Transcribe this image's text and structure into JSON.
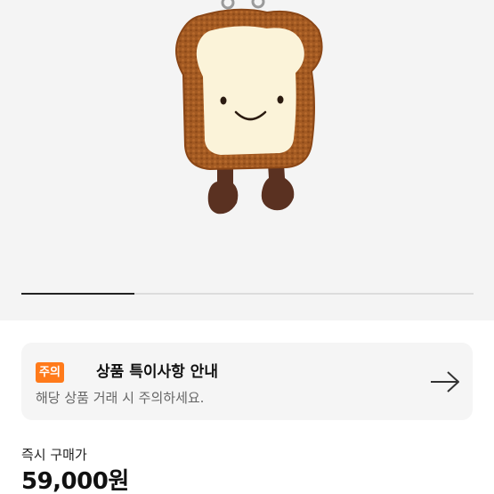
{
  "product": {
    "image_icon": "toast-plush-keyring-image",
    "carousel_progress": 0.25
  },
  "notice": {
    "badge": "주의",
    "title": "상품 특이사항 안내",
    "description": "해당 상품 거래 시 주의하세요.",
    "arrow_icon": "arrow-right-icon",
    "badge_color": "#ff7a1a"
  },
  "price": {
    "label": "즉시 구매가",
    "value": "59,000원"
  }
}
